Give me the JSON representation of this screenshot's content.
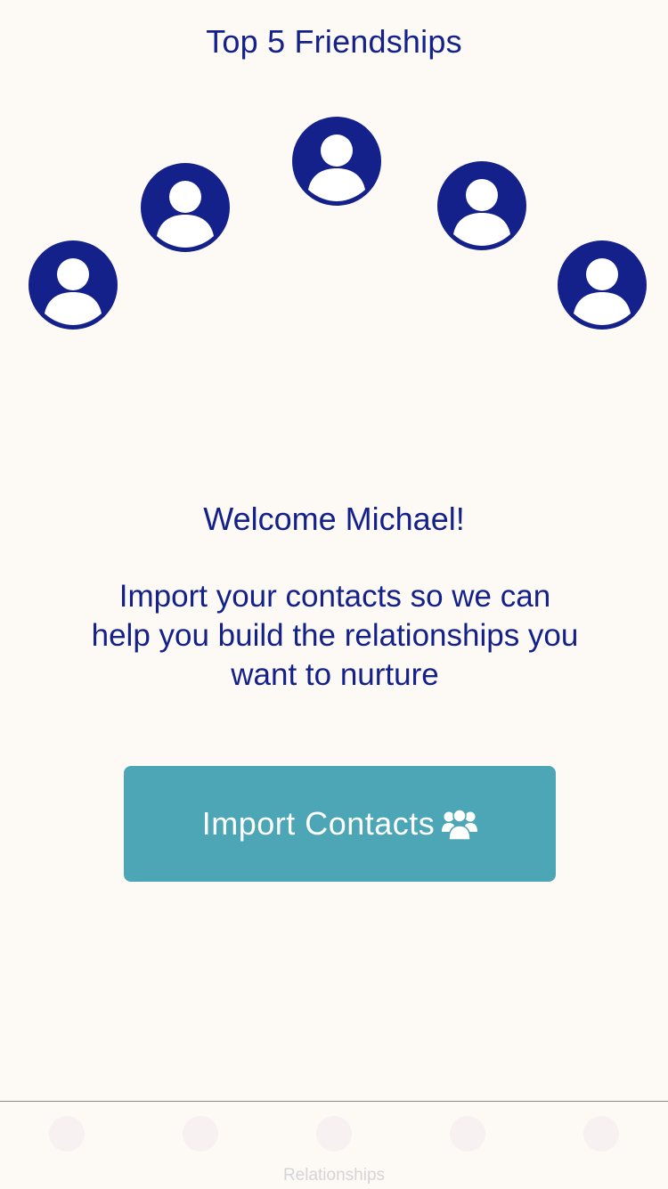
{
  "header": {
    "title": "Top 5 Friendships"
  },
  "friends": [
    {
      "name": ""
    },
    {
      "name": ""
    },
    {
      "name": ""
    },
    {
      "name": ""
    },
    {
      "name": ""
    }
  ],
  "welcome": {
    "greeting": "Welcome Michael!",
    "message": "Import your contacts so we can help you build the relationships you want to nurture"
  },
  "import_button": {
    "label": "Import Contacts",
    "icon": "users-icon"
  },
  "tabbar": {
    "tabs": [
      {
        "label": "",
        "icon": "friendships-icon"
      },
      {
        "label": "",
        "icon": "tab-icon"
      },
      {
        "label": "Relationships",
        "icon": "relationships-icon"
      },
      {
        "label": "",
        "icon": "tab-icon"
      },
      {
        "label": "",
        "icon": "tab-icon"
      }
    ]
  },
  "colors": {
    "background": "#fdf9f4",
    "primary_text": "#14218a",
    "avatar": "#14218a",
    "button": "#4da6b5",
    "button_text": "#ffffff"
  }
}
